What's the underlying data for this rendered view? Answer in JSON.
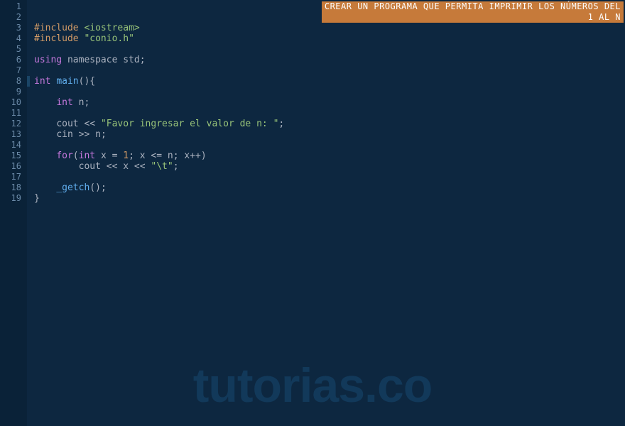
{
  "comment_banner": {
    "line1": "CREAR UN PROGRAMA QUE PERMITA IMPRIMIR LOS NÚMEROS DEL",
    "line2": "1 AL N"
  },
  "gutter": {
    "lines": [
      "1",
      "2",
      "3",
      "4",
      "5",
      "6",
      "7",
      "8",
      "9",
      "10",
      "11",
      "12",
      "13",
      "14",
      "15",
      "16",
      "17",
      "18",
      "19"
    ]
  },
  "code": {
    "l3": {
      "pre": "#include ",
      "inc": "<iostream>"
    },
    "l4": {
      "pre": "#include ",
      "inc": "\"conio.h\""
    },
    "l6": {
      "using": "using",
      "ns": " namespace std",
      "semi": ";"
    },
    "l8": {
      "type": "int ",
      "fn": "main",
      "paren": "(){"
    },
    "l10": {
      "indent": "    ",
      "type": "int ",
      "id": "n",
      "semi": ";"
    },
    "l12": {
      "indent": "    ",
      "id": "cout ",
      "op": "<< ",
      "str": "\"Favor ingresar el valor de n: \"",
      "semi": ";"
    },
    "l13": {
      "indent": "    ",
      "id": "cin ",
      "op": ">> ",
      "id2": "n",
      "semi": ";"
    },
    "l15": {
      "indent": "    ",
      "kw": "for",
      "p1": "(",
      "type": "int ",
      "id": "x ",
      "op1": "= ",
      "num": "1",
      "semi1": "; ",
      "id2": "x ",
      "op2": "<= ",
      "id3": "n",
      "semi2": "; ",
      "id4": "x",
      "op3": "++",
      "p2": ")"
    },
    "l16": {
      "indent": "        ",
      "id": "cout ",
      "op": "<< ",
      "id2": "x ",
      "op2": "<< ",
      "str": "\"\\t\"",
      "semi": ";"
    },
    "l18": {
      "indent": "    ",
      "fn": "_getch",
      "paren": "()",
      "semi": ";"
    },
    "l19": {
      "brace": "}"
    }
  },
  "watermark": "tutorias.co"
}
